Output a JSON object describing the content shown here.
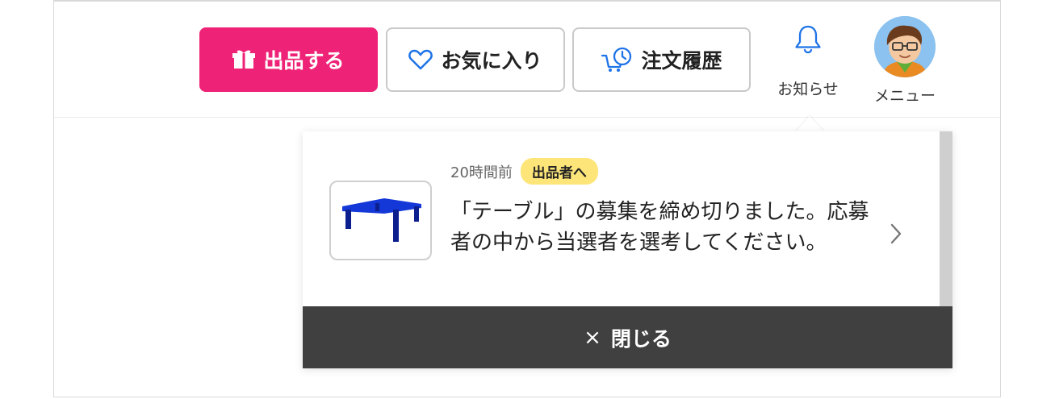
{
  "header": {
    "sell_button": {
      "label": "出品する",
      "icon": "gift-box-icon"
    },
    "favorites_button": {
      "label": "お気に入り",
      "icon": "heart-icon"
    },
    "orders_button": {
      "label": "注文履歴",
      "icon": "cart-history-icon"
    },
    "notifications": {
      "label": "お知らせ",
      "icon": "bell-icon"
    },
    "menu": {
      "label": "メニュー",
      "icon": "avatar"
    }
  },
  "notification_popover": {
    "items": [
      {
        "time": "20時間前",
        "badge": "出品者へ",
        "message": "「テーブル」の募集を締め切りました。応募者の中から当選者を選考してください。",
        "thumbnail": "table-thumbnail"
      }
    ],
    "close_label": "閉じる",
    "close_icon": "×"
  },
  "colors": {
    "accent": "#ee2276",
    "badge": "#fde57a",
    "close_bar": "#404040",
    "icon_blue": "#1e73e8"
  }
}
